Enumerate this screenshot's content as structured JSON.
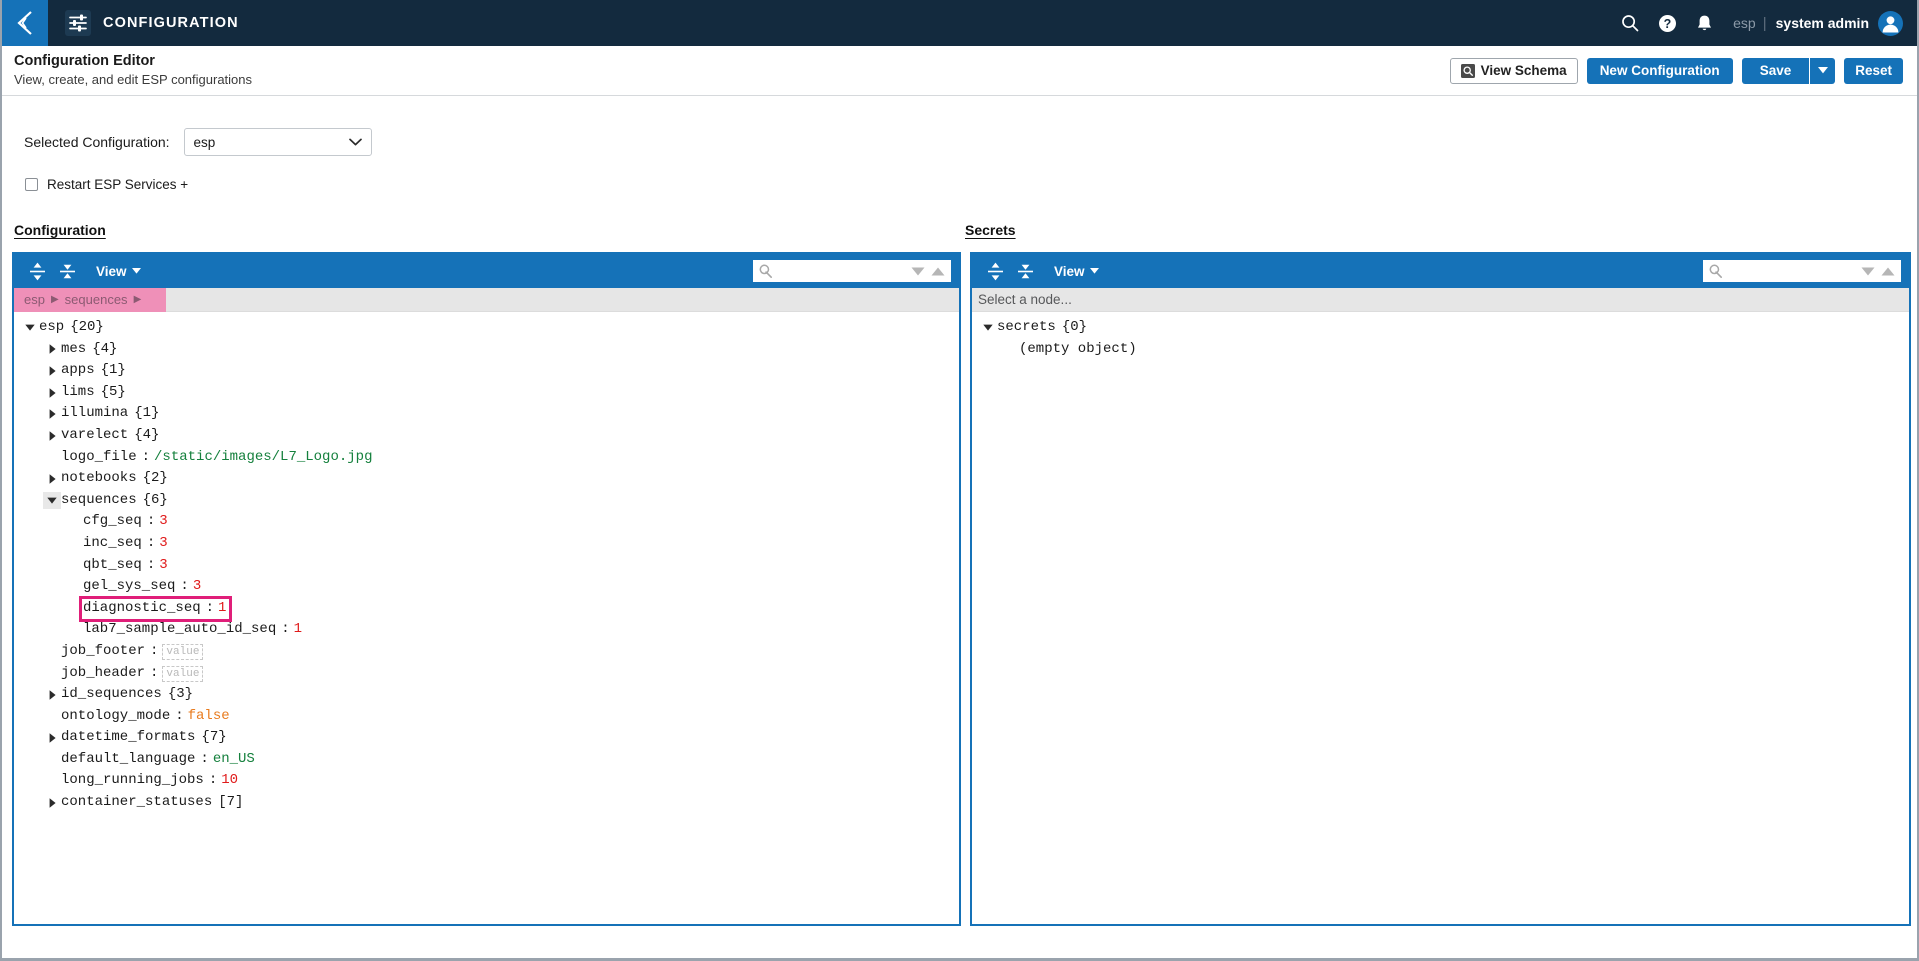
{
  "topbar": {
    "back_icon": "chevron-left-icon",
    "app_icon": "sliders-config-icon",
    "title": "CONFIGURATION",
    "search_icon": "search-icon",
    "help_icon": "help-circle-icon",
    "notifications_icon": "bell-icon",
    "tenant": "esp",
    "separator": "|",
    "username": "system admin",
    "avatar_icon": "user-avatar-icon",
    "bg_color": "#132a3e",
    "accent_color": "#1572b8"
  },
  "page_header": {
    "title": "Configuration Editor",
    "subtitle": "View, create, and edit ESP configurations",
    "buttons": {
      "view_schema": "View Schema",
      "view_schema_icon": "schema-magnifier-icon",
      "new_configuration": "New Configuration",
      "save": "Save",
      "save_dropdown_icon": "caret-down-icon",
      "reset": "Reset"
    }
  },
  "selector": {
    "label": "Selected Configuration:",
    "value": "esp",
    "chevron_icon": "chevron-down-icon",
    "options": [
      "esp"
    ]
  },
  "restart": {
    "label": "Restart ESP Services +",
    "checked": false
  },
  "sections": {
    "configuration_label": "Configuration",
    "secrets_label": "Secrets"
  },
  "config_panel": {
    "toolbar": {
      "expand_all_icon": "expand-all-icon",
      "collapse_all_icon": "collapse-all-icon",
      "view_label": "View",
      "view_caret_icon": "caret-down-icon",
      "search_placeholder": "",
      "search_value": "",
      "search_icon": "search-icon",
      "next_match_icon": "triangle-down-icon",
      "prev_match_icon": "triangle-up-icon"
    },
    "breadcrumb": [
      "esp",
      "sequences"
    ],
    "breadcrumb_arrow": "▶",
    "tree": [
      {
        "indent": 0,
        "twisty": "open",
        "key": "esp",
        "count": "{20}"
      },
      {
        "indent": 1,
        "twisty": "closed",
        "key": "mes",
        "count": "{4}"
      },
      {
        "indent": 1,
        "twisty": "closed",
        "key": "apps",
        "count": "{1}"
      },
      {
        "indent": 1,
        "twisty": "closed",
        "key": "lims",
        "count": "{5}"
      },
      {
        "indent": 1,
        "twisty": "closed",
        "key": "illumina",
        "count": "{1}"
      },
      {
        "indent": 1,
        "twisty": "closed",
        "key": "varelect",
        "count": "{4}"
      },
      {
        "indent": 1,
        "twisty": "none",
        "key": "logo_file",
        "value": "/static/images/L7_Logo.jpg",
        "vtype": "str"
      },
      {
        "indent": 1,
        "twisty": "closed",
        "key": "notebooks",
        "count": "{2}"
      },
      {
        "indent": 1,
        "twisty": "open",
        "key": "sequences",
        "count": "{6}",
        "selected": true
      },
      {
        "indent": 2,
        "twisty": "none",
        "key": "cfg_seq",
        "value": "3",
        "vtype": "num"
      },
      {
        "indent": 2,
        "twisty": "none",
        "key": "inc_seq",
        "value": "3",
        "vtype": "num"
      },
      {
        "indent": 2,
        "twisty": "none",
        "key": "qbt_seq",
        "value": "3",
        "vtype": "num"
      },
      {
        "indent": 2,
        "twisty": "none",
        "key": "gel_sys_seq",
        "value": "3",
        "vtype": "num"
      },
      {
        "indent": 2,
        "twisty": "none",
        "key": "diagnostic_seq",
        "value": "1",
        "vtype": "num",
        "highlight": true
      },
      {
        "indent": 2,
        "twisty": "none",
        "key": "lab7_sample_auto_id_seq",
        "value": "1",
        "vtype": "num"
      },
      {
        "indent": 1,
        "twisty": "none",
        "key": "job_footer",
        "value": "value",
        "vtype": "empty"
      },
      {
        "indent": 1,
        "twisty": "none",
        "key": "job_header",
        "value": "value",
        "vtype": "empty"
      },
      {
        "indent": 1,
        "twisty": "closed",
        "key": "id_sequences",
        "count": "{3}"
      },
      {
        "indent": 1,
        "twisty": "none",
        "key": "ontology_mode",
        "value": "false",
        "vtype": "bool"
      },
      {
        "indent": 1,
        "twisty": "closed",
        "key": "datetime_formats",
        "count": "{7}"
      },
      {
        "indent": 1,
        "twisty": "none",
        "key": "default_language",
        "value": "en_US",
        "vtype": "str"
      },
      {
        "indent": 1,
        "twisty": "none",
        "key": "long_running_jobs",
        "value": "10",
        "vtype": "num"
      },
      {
        "indent": 1,
        "twisty": "closed",
        "key": "container_statuses",
        "count": "[7]"
      }
    ]
  },
  "secrets_panel": {
    "toolbar": {
      "expand_all_icon": "expand-all-icon",
      "collapse_all_icon": "collapse-all-icon",
      "view_label": "View",
      "view_caret_icon": "caret-down-icon",
      "search_placeholder": "",
      "search_value": "",
      "search_icon": "search-icon",
      "next_match_icon": "triangle-down-icon",
      "prev_match_icon": "triangle-up-icon"
    },
    "node_placeholder": "Select a node...",
    "tree": [
      {
        "indent": 0,
        "twisty": "open",
        "key": "secrets",
        "count": "{0}"
      },
      {
        "indent": 1,
        "twisty": "none",
        "note": "(empty object)"
      }
    ]
  }
}
